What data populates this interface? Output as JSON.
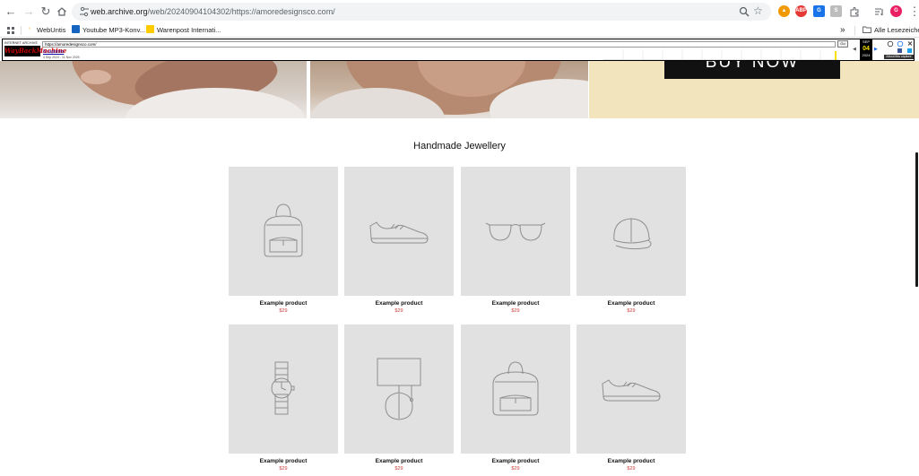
{
  "browser": {
    "url_host": "web.archive.org",
    "url_path": "/web/20240904104302/https://amoredesignsco.com/",
    "profile_initial": "G",
    "bookmarks": [
      {
        "label": "WebUntis",
        "icon_color": "#f5a623"
      },
      {
        "label": "Youtube MP3-Konv...",
        "icon_color": "#1565c0"
      },
      {
        "label": "Warenpost Internati...",
        "icon_color": "#ffcc00"
      }
    ],
    "all_bookmarks_label": "Alle Lesezeichen"
  },
  "wayback": {
    "logo_line1": "INTERNET ARCHIVE",
    "logo_line2": "WayBackMachine",
    "url_value": "https://amoredesignsco.com/",
    "go_label": "Go",
    "captures_label": "8 captures",
    "range_label": "4 Sep 2024 - 11 Nov 2025",
    "month": "SEP",
    "day": "04",
    "year": "2024",
    "about_label": "About this capture"
  },
  "hero": {
    "cta_label": "BUY NOW",
    "cta_bg": "#111111",
    "banner_bg": "#f2e4bd"
  },
  "section": {
    "title": "Handmade Jewellery"
  },
  "products": [
    {
      "name": "Example product",
      "price": "$29",
      "icon": "backpack-icon"
    },
    {
      "name": "Example product",
      "price": "$29",
      "icon": "sneaker-icon"
    },
    {
      "name": "Example product",
      "price": "$29",
      "icon": "sunglasses-icon"
    },
    {
      "name": "Example product",
      "price": "$29",
      "icon": "cap-icon"
    },
    {
      "name": "Example product",
      "price": "$29",
      "icon": "watch-icon"
    },
    {
      "name": "Example product",
      "price": "$29",
      "icon": "lamp-icon"
    },
    {
      "name": "Example product",
      "price": "$29",
      "icon": "backpack-icon"
    },
    {
      "name": "Example product",
      "price": "$29",
      "icon": "sneaker-icon"
    }
  ],
  "colors": {
    "price": "#c94040",
    "card_bg": "#e1e1e1",
    "wayback_day": "#f9df00"
  }
}
